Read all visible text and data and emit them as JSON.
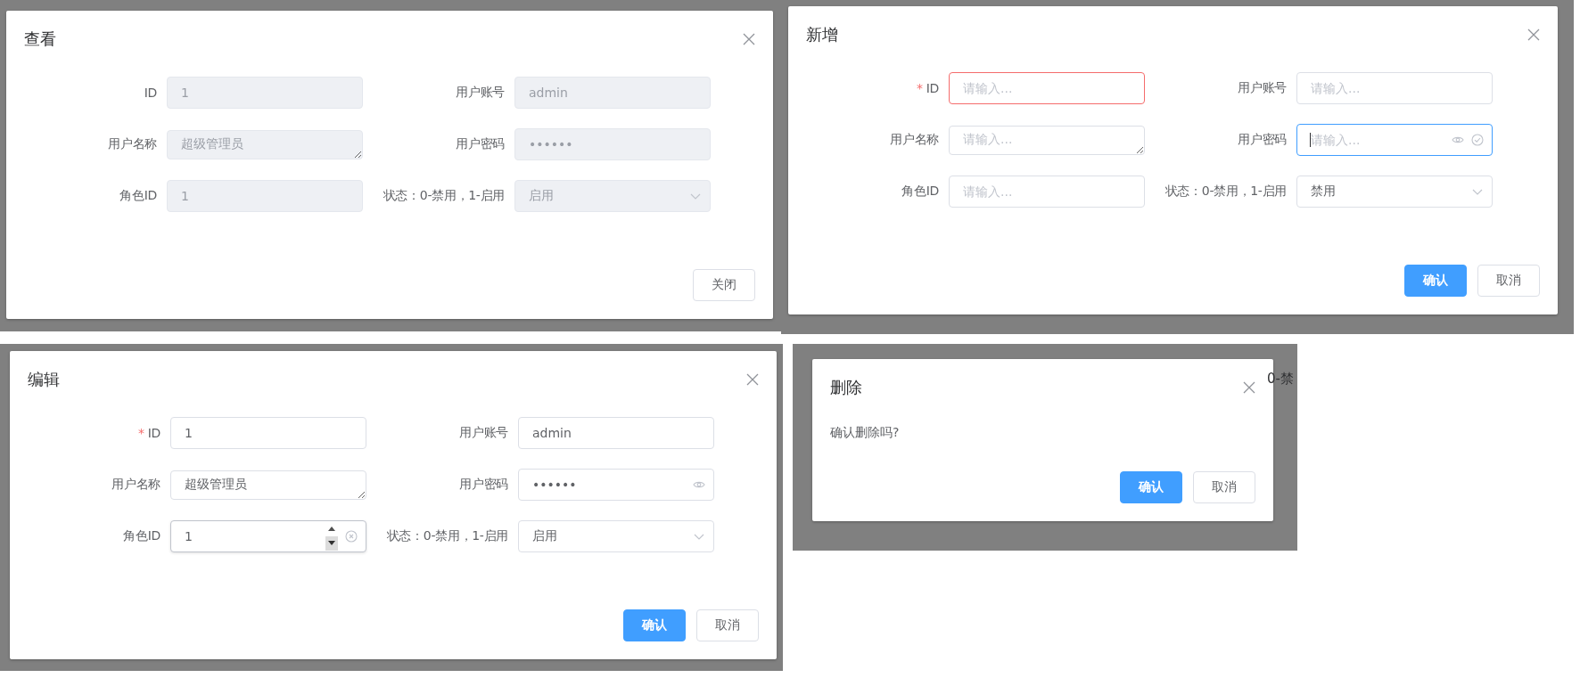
{
  "dialogs": [
    {
      "kind": "form",
      "title": "查看",
      "fields": [
        {
          "label": "ID",
          "kind": "text",
          "value": "1",
          "disabled": true,
          "error": false,
          "focused": false,
          "hover": false,
          "validated": false,
          "clearable": false
        },
        {
          "label": "用户账号",
          "kind": "text",
          "value": "admin",
          "disabled": true,
          "error": false,
          "focused": false,
          "hover": false,
          "validated": false,
          "clearable": false
        },
        {
          "label": "用户名称",
          "kind": "textarea",
          "value": "超级管理员",
          "disabled": true,
          "error": false,
          "focused": false,
          "hover": false,
          "validated": false,
          "clearable": false
        },
        {
          "label": "用户密码",
          "kind": "password",
          "value": "••••••",
          "disabled": true,
          "error": false,
          "focused": false,
          "hover": false,
          "validated": false,
          "clearable": false
        },
        {
          "label": "角色ID",
          "kind": "text",
          "value": "1",
          "disabled": true,
          "error": false,
          "focused": false,
          "hover": false,
          "validated": false,
          "clearable": false
        },
        {
          "label": "状态：0-禁用，1-启用",
          "kind": "select",
          "value": "启用",
          "disabled": true,
          "error": false,
          "focused": false,
          "hover": false,
          "validated": false,
          "clearable": false
        }
      ],
      "buttons": [
        {
          "label": "关闭",
          "primary": false
        }
      ]
    },
    {
      "kind": "form",
      "title": "新增",
      "fields": [
        {
          "label": "ID",
          "required_mark": "*",
          "kind": "text",
          "placeholder": "请输入...",
          "disabled": false,
          "error": true,
          "focused": false,
          "hover": false,
          "validated": false,
          "clearable": false
        },
        {
          "label": "用户账号",
          "kind": "text",
          "placeholder": "请输入...",
          "disabled": false,
          "error": false,
          "focused": false,
          "hover": false,
          "validated": false,
          "clearable": false
        },
        {
          "label": "用户名称",
          "kind": "textarea",
          "placeholder": "请输入...",
          "disabled": false,
          "error": false,
          "focused": false,
          "hover": false,
          "validated": false,
          "clearable": false
        },
        {
          "label": "用户密码",
          "kind": "password",
          "placeholder": "请输入...",
          "disabled": false,
          "error": false,
          "focused": true,
          "hover": false,
          "validated": true,
          "clearable": false
        },
        {
          "label": "角色ID",
          "kind": "text",
          "placeholder": "请输入...",
          "disabled": false,
          "error": false,
          "focused": false,
          "hover": false,
          "validated": false,
          "clearable": false
        },
        {
          "label": "状态：0-禁用，1-启用",
          "kind": "select",
          "value": "禁用",
          "disabled": false,
          "error": false,
          "focused": false,
          "hover": false,
          "validated": false,
          "clearable": false
        }
      ],
      "buttons": [
        {
          "label": "确认",
          "primary": true
        },
        {
          "label": "取消",
          "primary": false
        }
      ]
    },
    {
      "kind": "form",
      "title": "编辑",
      "fields": [
        {
          "label": "ID",
          "required_mark": "*",
          "kind": "text",
          "value": "1",
          "disabled": false,
          "error": false,
          "focused": false,
          "hover": false,
          "validated": false,
          "clearable": false
        },
        {
          "label": "用户账号",
          "kind": "text",
          "value": "admin",
          "disabled": false,
          "error": false,
          "focused": false,
          "hover": false,
          "validated": false,
          "clearable": false
        },
        {
          "label": "用户名称",
          "kind": "textarea",
          "value": "超级管理员",
          "disabled": false,
          "error": false,
          "focused": false,
          "hover": false,
          "validated": false,
          "clearable": false
        },
        {
          "label": "用户密码",
          "kind": "password",
          "value": "••••••",
          "disabled": false,
          "error": false,
          "focused": false,
          "hover": false,
          "validated": false,
          "clearable": false
        },
        {
          "label": "角色ID",
          "kind": "number",
          "value": "1",
          "disabled": false,
          "error": false,
          "focused": false,
          "hover": true,
          "validated": false,
          "clearable": true
        },
        {
          "label": "状态：0-禁用，1-启用",
          "kind": "select",
          "value": "启用",
          "disabled": false,
          "error": false,
          "focused": false,
          "hover": false,
          "validated": false,
          "clearable": false
        }
      ],
      "buttons": [
        {
          "label": "确认",
          "primary": true
        },
        {
          "label": "取消",
          "primary": false
        }
      ]
    },
    {
      "kind": "confirm",
      "title": "删除",
      "message": "确认删除吗?",
      "backdrop_text": "0-禁",
      "buttons": [
        {
          "label": "确认",
          "primary": true
        },
        {
          "label": "取消",
          "primary": false
        }
      ]
    }
  ]
}
